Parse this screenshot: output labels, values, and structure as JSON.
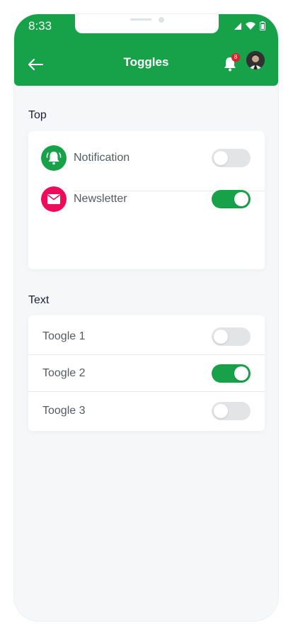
{
  "status_bar": {
    "time": "8:33"
  },
  "header": {
    "title": "Toggles",
    "back_icon": "arrow-left-icon",
    "notification_count": "8",
    "background_color": "#17a24a"
  },
  "sections": {
    "top": {
      "title": "Top",
      "items": [
        {
          "label": "Notification",
          "icon": "bell-icon",
          "icon_color": "#17a24a",
          "on": false
        },
        {
          "label": "Newsletter",
          "icon": "mail-icon",
          "icon_color": "#f00a5c",
          "on": true
        }
      ]
    },
    "text": {
      "title": "Text",
      "items": [
        {
          "label": "Toogle 1",
          "on": false
        },
        {
          "label": "Toogle 2",
          "on": true
        },
        {
          "label": "Toogle 3",
          "on": false
        }
      ]
    }
  },
  "colors": {
    "accent": "#17a24a",
    "toggle_off": "#e3e4e6",
    "background": "#f6f7f9"
  }
}
